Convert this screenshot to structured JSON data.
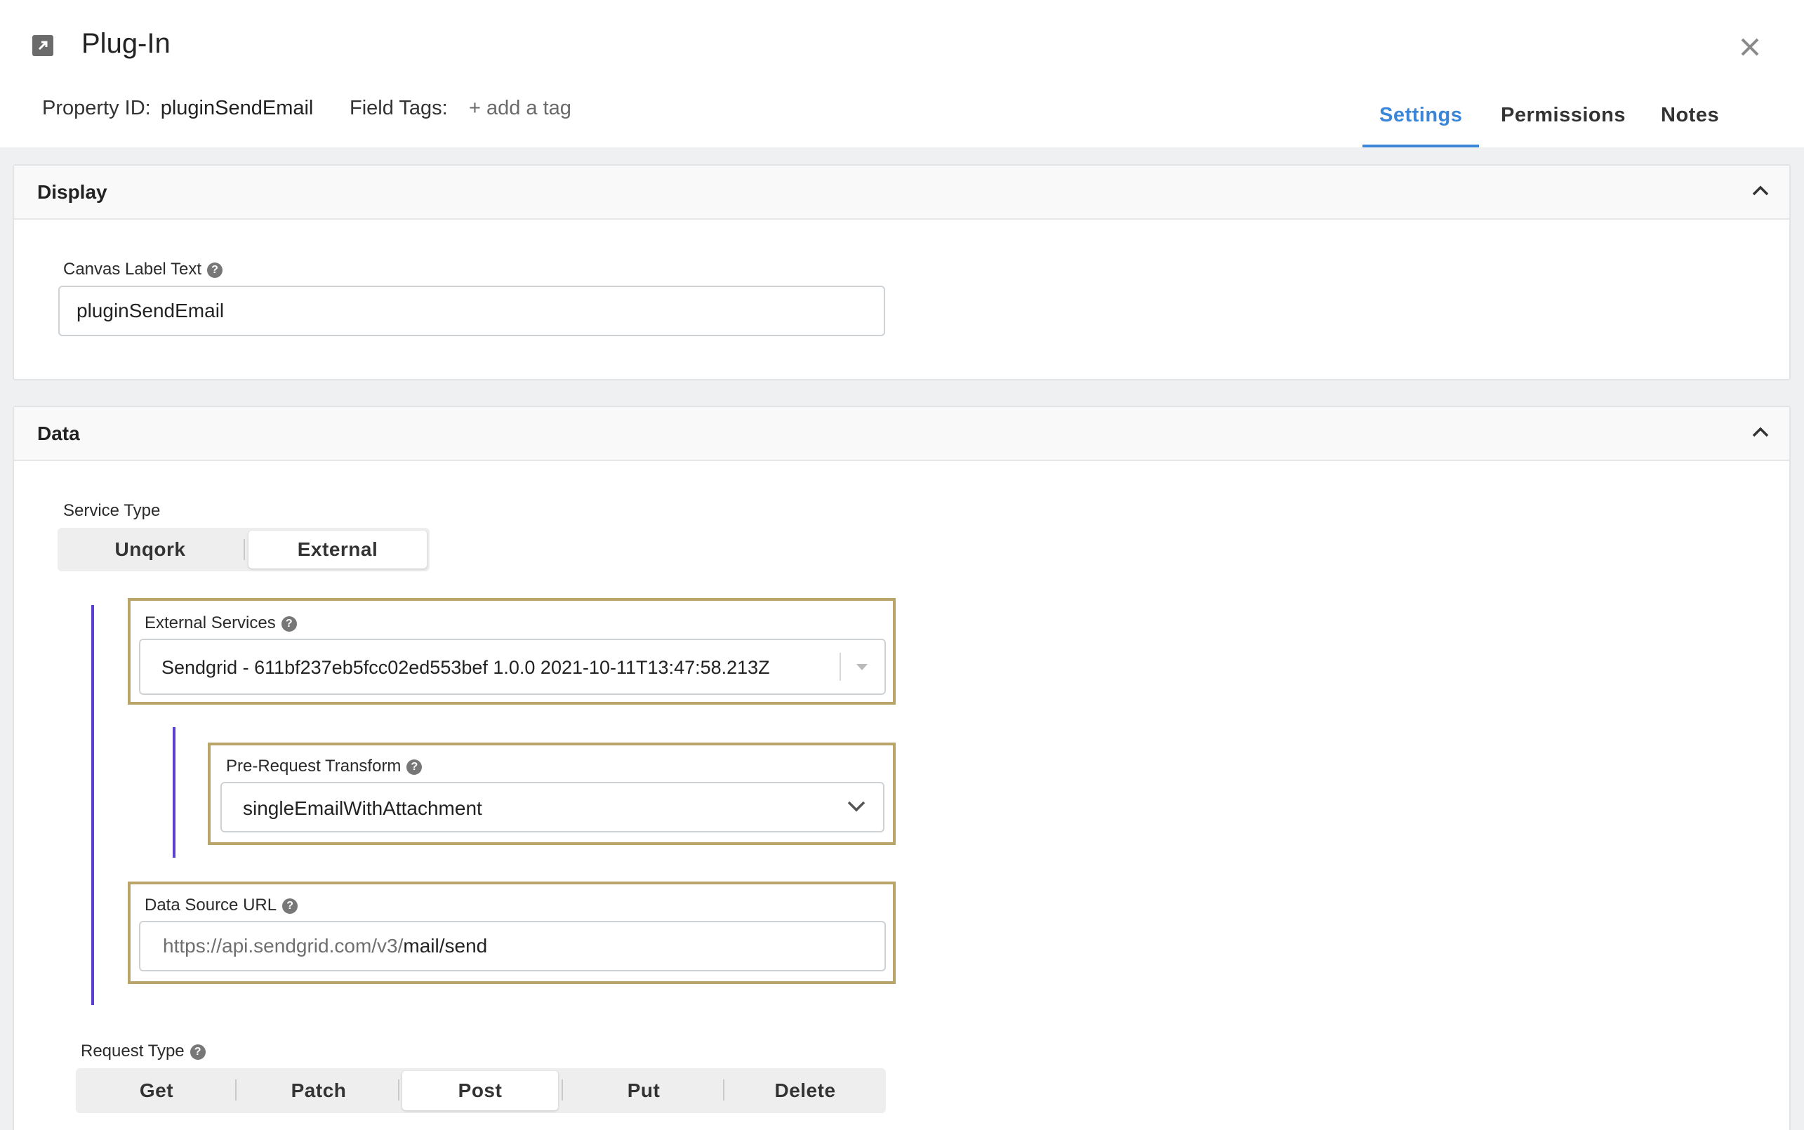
{
  "header": {
    "title": "Plug-In",
    "property_id_label": "Property ID:",
    "property_id_value": "pluginSendEmail",
    "field_tags_label": "Field Tags:",
    "add_tag_label": "+ add a tag",
    "tabs": [
      {
        "label": "Settings",
        "active": true
      },
      {
        "label": "Permissions",
        "active": false
      },
      {
        "label": "Notes",
        "active": false
      }
    ]
  },
  "display_panel": {
    "title": "Display",
    "canvas_label_text_label": "Canvas Label Text",
    "canvas_label_text_value": "pluginSendEmail"
  },
  "data_panel": {
    "title": "Data",
    "service_type_label": "Service Type",
    "service_type_options": [
      "Unqork",
      "External"
    ],
    "service_type_selected": "External",
    "external_services_label": "External Services",
    "external_services_value": "Sendgrid - 611bf237eb5fcc02ed553bef 1.0.0 2021-10-11T13:47:58.213Z",
    "pre_request_transform_label": "Pre-Request Transform",
    "pre_request_transform_value": "singleEmailWithAttachment",
    "data_source_url_label": "Data Source URL",
    "data_source_url_prefix": "https://api.sendgrid.com/v3/",
    "data_source_url_path": "mail/send",
    "request_type_label": "Request Type",
    "request_type_options": [
      "Get",
      "Patch",
      "Post",
      "Put",
      "Delete"
    ],
    "request_type_selected": "Post"
  },
  "colors": {
    "accent": "#3a86d8",
    "highlight_border": "#b9a46a",
    "indent_line": "#5a3fd1"
  },
  "icons": [
    "external-link-icon",
    "close-icon",
    "chevron-up-icon",
    "help-icon",
    "dropdown-caret-icon",
    "chevron-down-icon"
  ]
}
